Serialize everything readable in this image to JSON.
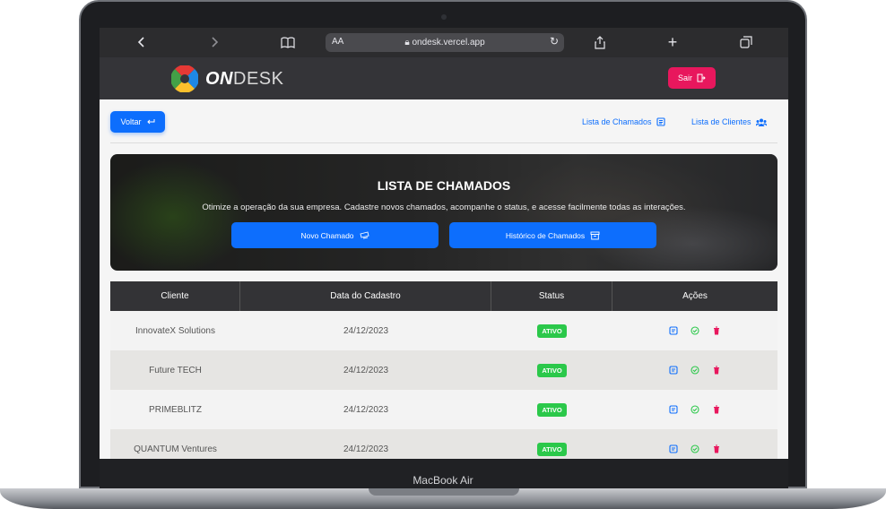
{
  "device": {
    "label": "MacBook Air"
  },
  "browser": {
    "text_size_label": "AA",
    "url": "ondesk.vercel.app"
  },
  "header": {
    "brand_bold": "ON",
    "brand_light": "DESK",
    "logout_label": "Sair"
  },
  "subnav": {
    "back_label": "Voltar",
    "links": [
      {
        "label": "Lista de Chamados",
        "icon": "list-icon"
      },
      {
        "label": "Lista de Clientes",
        "icon": "users-icon"
      }
    ]
  },
  "hero": {
    "title": "LISTA DE CHAMADOS",
    "subtitle": "Otimize a operação da sua empresa. Cadastre novos chamados, acompanhe o status, e acesse facilmente todas as interações.",
    "buttons": [
      {
        "label": "Novo Chamado",
        "icon": "add-ticket-icon"
      },
      {
        "label": "Histórico de Chamados",
        "icon": "archive-icon"
      }
    ]
  },
  "table": {
    "columns": [
      "Cliente",
      "Data do Cadastro",
      "Status",
      "Ações"
    ],
    "rows": [
      {
        "cliente": "InnovateX Solutions",
        "data": "24/12/2023",
        "status": "ATIVO"
      },
      {
        "cliente": "Future TECH",
        "data": "24/12/2023",
        "status": "ATIVO"
      },
      {
        "cliente": "PRIMEBLITZ",
        "data": "24/12/2023",
        "status": "ATIVO"
      },
      {
        "cliente": "QUANTUM Ventures",
        "data": "24/12/2023",
        "status": "ATIVO"
      }
    ]
  },
  "colors": {
    "primary": "#0d6efd",
    "danger": "#e8175d",
    "success": "#2bc84a",
    "header_bg": "#343438"
  }
}
